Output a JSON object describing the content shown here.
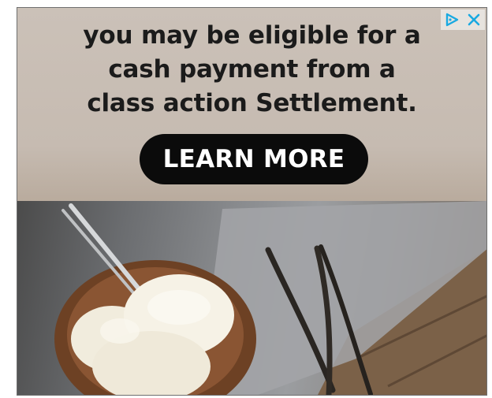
{
  "ad": {
    "headline_lines": [
      "you may be eligible for a",
      "cash payment from a",
      "class action Settlement."
    ],
    "cta_label": "LEARN MORE",
    "adchoices_icon": "adchoices-triangle-icon",
    "close_icon": "close-x-icon",
    "accent_color": "#19a9e1",
    "button_color": "#0b0b0b",
    "image_subject": "ice-cream-bowl-with-vanilla-beans"
  }
}
